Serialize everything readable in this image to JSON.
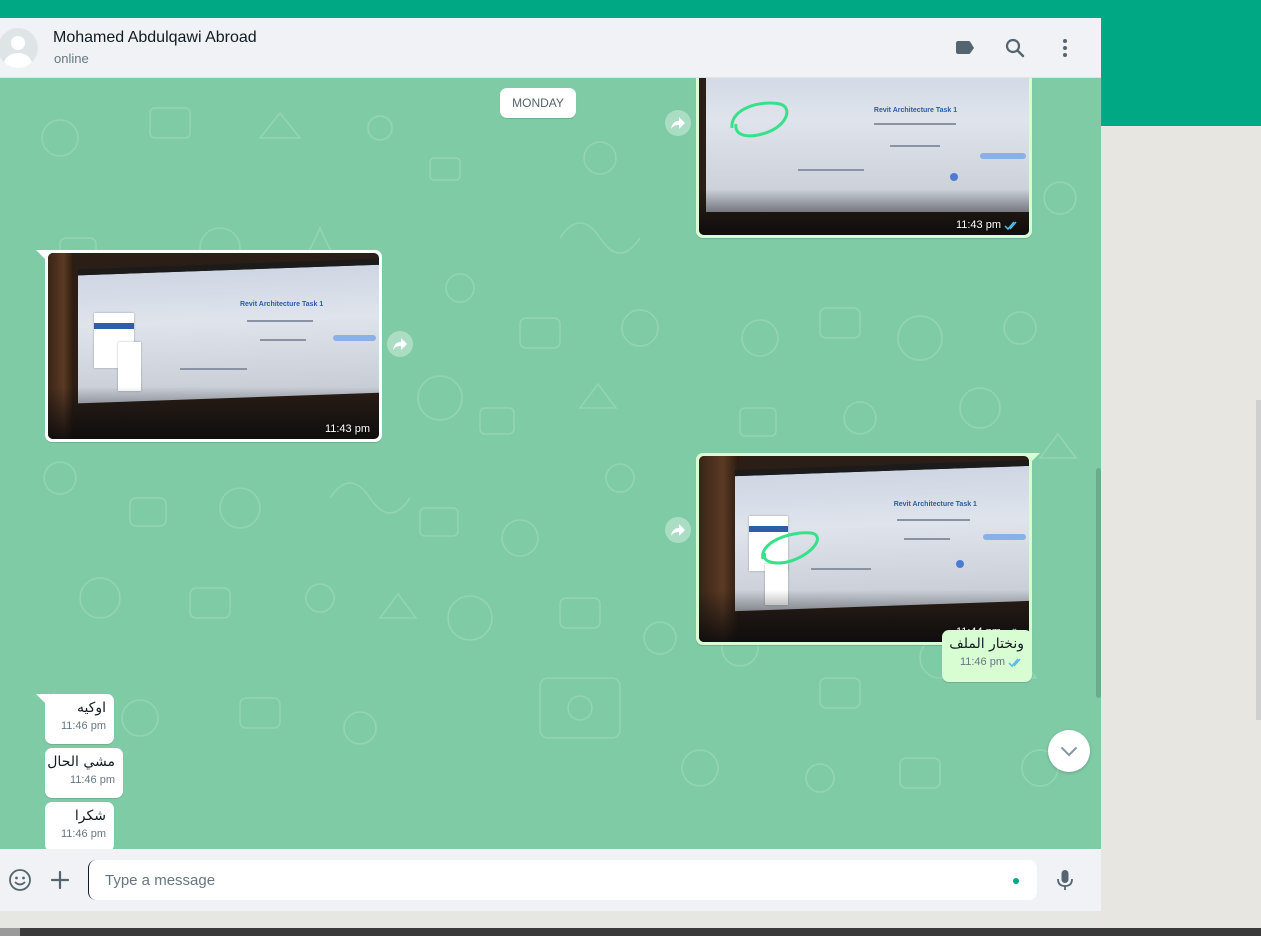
{
  "header": {
    "contact_name": "Mohamed Abdulqawi Abroad",
    "contact_status": "online",
    "icons": [
      "label-icon",
      "search-icon",
      "menu-icon"
    ]
  },
  "day_separator": "MONDAY",
  "messages": [
    {
      "type": "image",
      "direction": "outgoing",
      "time": "11:43 pm",
      "status": "read",
      "photo_text": "Revit Architecture Task 1"
    },
    {
      "type": "image",
      "direction": "incoming",
      "time": "11:43 pm",
      "photo_text": "Revit Architecture Task 1"
    },
    {
      "type": "image",
      "direction": "outgoing",
      "time": "11:44 pm",
      "status": "read",
      "photo_text": "Revit Architecture Task 1"
    },
    {
      "type": "text",
      "direction": "outgoing",
      "text": "ونختار الملف",
      "time": "11:46 pm",
      "status": "read"
    },
    {
      "type": "text",
      "direction": "incoming",
      "text": "اوكيه",
      "time": "11:46 pm"
    },
    {
      "type": "text",
      "direction": "incoming",
      "text": "مشي الحال",
      "time": "11:46 pm"
    },
    {
      "type": "text",
      "direction": "incoming",
      "text": "شكرا",
      "time": "11:46 pm"
    }
  ],
  "composer": {
    "placeholder": "Type a message",
    "icons": [
      "emoji-icon",
      "attach-plus-icon",
      "microphone-icon"
    ]
  },
  "colors": {
    "accent": "#00a884",
    "outgoing_bubble": "#d9fdd3",
    "incoming_bubble": "#ffffff",
    "wallpaper": "#7fcba6",
    "read_tick": "#53bdeb"
  }
}
